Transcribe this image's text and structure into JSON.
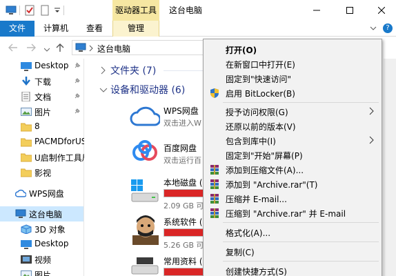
{
  "title_bar": {
    "context_tab_group": "驱动器工具",
    "window_title": "这台电脑"
  },
  "ribbon": {
    "tabs": [
      {
        "label": "文件"
      },
      {
        "label": "计算机"
      },
      {
        "label": "查看"
      },
      {
        "label": "管理"
      }
    ]
  },
  "address_bar": {
    "path": "这台电脑"
  },
  "nav_pane": {
    "items": [
      {
        "label": "Desktop",
        "icon": "desktop-icon",
        "pinned": true
      },
      {
        "label": "下载",
        "icon": "download-icon",
        "pinned": true
      },
      {
        "label": "文档",
        "icon": "documents-icon",
        "pinned": true
      },
      {
        "label": "图片",
        "icon": "pictures-icon",
        "pinned": true
      },
      {
        "label": "8",
        "icon": "folder-icon",
        "pinned": false
      },
      {
        "label": "PACMDforUS",
        "icon": "folder-icon",
        "pinned": false
      },
      {
        "label": "U启制作工具局",
        "icon": "folder-icon",
        "pinned": false
      },
      {
        "label": "影视",
        "icon": "folder-icon",
        "pinned": false
      },
      {
        "label": "WPS网盘",
        "icon": "cloud-icon",
        "pinned": false
      },
      {
        "label": "这台电脑",
        "icon": "computer-icon",
        "pinned": false
      },
      {
        "label": "3D 对象",
        "icon": "3d-objects-icon",
        "pinned": false
      },
      {
        "label": "Desktop",
        "icon": "desktop-icon",
        "pinned": false
      },
      {
        "label": "视频",
        "icon": "videos-icon",
        "pinned": false
      },
      {
        "label": "图片",
        "icon": "pictures-icon",
        "pinned": false
      }
    ]
  },
  "content": {
    "groups": [
      {
        "label": "文件夹 (7)"
      },
      {
        "label": "设备和驱动器 (6)"
      }
    ],
    "devices": [
      {
        "name": "WPS网盘",
        "sub": "双击进入W"
      },
      {
        "name": "百度网盘",
        "sub": "双击运行百"
      },
      {
        "name": "本地磁盘 (C",
        "size": "2.09 GB 可"
      },
      {
        "name": "系统软件 (D",
        "size": "5.26 GB 可"
      },
      {
        "name": "常用资料 (E",
        "size": ""
      }
    ]
  },
  "context_menu": {
    "items": [
      {
        "label": "打开(O)",
        "bold": true
      },
      {
        "label": "在新窗口中打开(E)"
      },
      {
        "label": "固定到\"快速访问\""
      },
      {
        "label": "启用 BitLocker(B)",
        "icon": "shield-icon"
      },
      {
        "label": "授予访问权限(G)",
        "submenu": true
      },
      {
        "label": "还原以前的版本(V)"
      },
      {
        "label": "包含到库中(I)",
        "submenu": true
      },
      {
        "label": "固定到\"开始\"屏幕(P)"
      },
      {
        "label": "添加到压缩文件(A)...",
        "icon": "winrar-icon"
      },
      {
        "label": "添加到 \"Archive.rar\"(T)",
        "icon": "winrar-icon"
      },
      {
        "label": "压缩并 E-mail...",
        "icon": "winrar-icon"
      },
      {
        "label": "压缩到 \"Archive.rar\" 并 E-mail",
        "icon": "winrar-icon"
      },
      {
        "label": "格式化(A)..."
      },
      {
        "label": "复制(C)"
      },
      {
        "label": "创建快捷方式(S)"
      }
    ]
  },
  "colors": {
    "file_tab": "#1979ca",
    "context_tab": "#f6e7a2",
    "group_header": "#1e3287",
    "drive_bar_full": "#da2626",
    "nav_selected": "#cce8ff"
  }
}
